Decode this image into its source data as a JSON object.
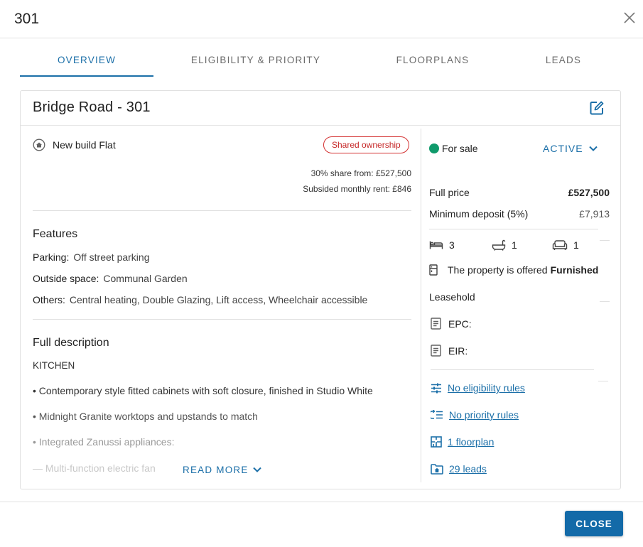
{
  "dialog": {
    "title": "301",
    "close_button_label": "CLOSE"
  },
  "tabs": [
    {
      "label": "OVERVIEW",
      "active": true
    },
    {
      "label": "ELIGIBILITY & PRIORITY",
      "active": false
    },
    {
      "label": "FLOORPLANS",
      "active": false
    },
    {
      "label": "LEADS",
      "active": false
    }
  ],
  "card": {
    "title": "Bridge Road - 301",
    "property_type": "New build Flat",
    "badge": "Shared ownership",
    "share_price": "30% share from: £527,500",
    "monthly_rent": "Subsided monthly rent: £846",
    "features": {
      "heading": "Features",
      "items": [
        {
          "key": "Parking:",
          "value": "Off street parking"
        },
        {
          "key": "Outside space:",
          "value": "Communal Garden"
        },
        {
          "key": "Others:",
          "value": "Central heating, Double Glazing, Lift access, Wheelchair accessible"
        }
      ]
    },
    "description": {
      "heading": "Full description",
      "lines": [
        "KITCHEN",
        "• Contemporary style fitted cabinets with soft closure, finished in Studio White",
        "• Midnight Granite worktops and upstands to match",
        "• Integrated Zanussi appliances:",
        "— Multi-function electric fan"
      ],
      "read_more": "READ MORE"
    },
    "sidebar": {
      "status": "For sale",
      "status_color": "#0f9a6b",
      "state_select": "ACTIVE",
      "full_price_label": "Full price",
      "full_price_value": "£527,500",
      "deposit_label": "Minimum deposit (5%)",
      "deposit_value": "£7,913",
      "bedrooms": "3",
      "bathrooms": "1",
      "living_rooms": "1",
      "furnished_prefix": "The property is offered",
      "furnished_value": "Furnished",
      "tenure": "Leasehold",
      "epc_label": "EPC:",
      "eir_label": "EIR:",
      "links": [
        {
          "label": "No eligibility rules",
          "icon": "sliders-icon"
        },
        {
          "label": "No priority rules",
          "icon": "priority-list-icon"
        },
        {
          "label": "1 floorplan",
          "icon": "floorplan-icon"
        },
        {
          "label": "29 leads",
          "icon": "folder-leads-icon"
        }
      ]
    }
  },
  "colors": {
    "accent": "#1b6fa8",
    "badge_red": "#c62828",
    "status_green": "#0f9a6b"
  }
}
